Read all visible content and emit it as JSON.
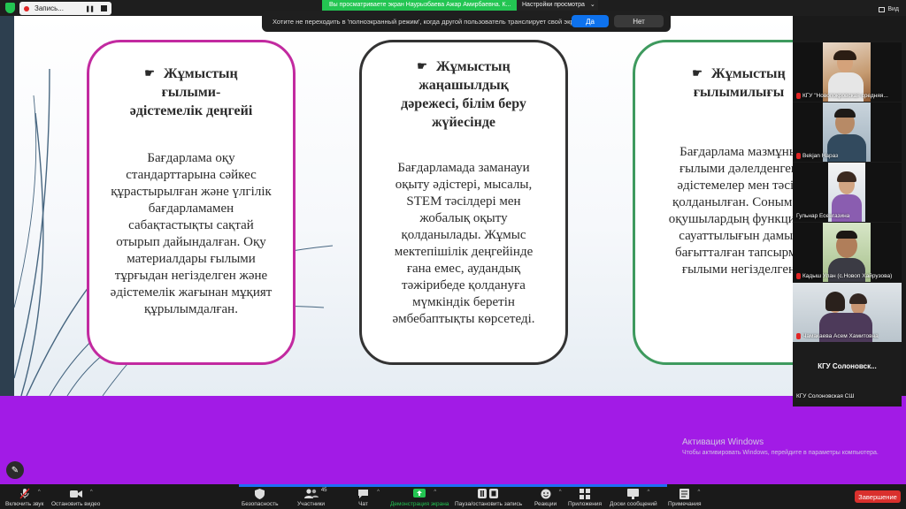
{
  "topbar": {
    "recording_label": "Запись...",
    "share_banner": "Вы просматриваете экран Наурызбаева Ажар Амирбаевна. К...",
    "view_settings": "Настройки просмотра",
    "view_label": "Вид"
  },
  "fullscreen_prompt": {
    "question": "Хотите не переходить в 'полноэкранный режим', когда другой пользователь транслирует свой экран?",
    "yes": "Да",
    "no": "Нет"
  },
  "slide": {
    "cards": [
      {
        "title_lines": [
          "Жұмыстың",
          "ғылыми-",
          "әдістемелік деңгейі"
        ],
        "body_lines": [
          "Бағдарлама оқу",
          "стандарттарына сәйкес",
          "құрастырылған және үлгілік",
          "бағдарламамен",
          "сабақтастықты сақтай",
          "отырып дайындалған. Оқу",
          "материалдары ғылыми",
          "тұрғыдан негізделген және",
          "әдістемелік жағынан мұқият",
          "құрылымдалған."
        ]
      },
      {
        "title_lines": [
          "Жұмыстың",
          "жаңашылдық",
          "дәрежесі, білім беру",
          "жүйесінде"
        ],
        "body_lines": [
          "Бағдарламада заманауи",
          "оқыту әдістері, мысалы,",
          "STEM тәсілдері мен",
          "жобалық оқыту",
          "қолданылады. Жұмыс",
          "мектепішілік деңгейінде",
          "ғана емес, аудандық",
          "тәжірибеде қолдануға",
          "мүмкіндік беретін",
          "әмбебаптықты көрсетеді."
        ]
      },
      {
        "title_lines": [
          "Жұмыстың",
          "ғылымилығы"
        ],
        "body_lines": [
          "Бағдарлама мазмұны",
          "ғылыми дәлелденген",
          "әдістемелер мен тәсіл",
          "қолданылған. Сонымен",
          "оқушылардың функцион",
          "сауаттылығын дамыт",
          "бағытталған тапсырма",
          "ғылыми негізделген"
        ]
      }
    ]
  },
  "participants": [
    {
      "name": "КГУ \"Новопокровская средняя..."
    },
    {
      "name": "Bekjan Нараз"
    },
    {
      "name": "Гульнар Есенгазина"
    },
    {
      "name": "Кадыш Улан (с.Новоп Хайрузова)"
    },
    {
      "name": "Чамакаева Асем Хамитовна"
    },
    {
      "name": "КГУ Солоновская СШ",
      "tile_text": "КГУ  Солоновск..."
    }
  ],
  "windows_activation": {
    "title": "Активация Windows",
    "text": "Чтобы активировать Windows, перейдите в параметры компьютера."
  },
  "toolbar": {
    "unmute": "Включить звук",
    "start_video": "Остановить видео",
    "security": "Безопасность",
    "participants": "Участники",
    "participants_count": "45",
    "chat": "Чат",
    "share_screen": "Демонстрация экрана",
    "pause_recording": "Пауза/остановить запись",
    "reactions": "Реакции",
    "apps": "Приложения",
    "whiteboards": "Доски сообщений",
    "notes": "Примечания",
    "end": "Завершение"
  },
  "colors": {
    "pink_border": "#c22aa0",
    "dark_border": "#333333",
    "green_border": "#3e9a5e",
    "purple_area": "#a21be6",
    "zoom_green": "#23c552",
    "zoom_blue": "#0e72ed",
    "end_red": "#d9302d"
  }
}
